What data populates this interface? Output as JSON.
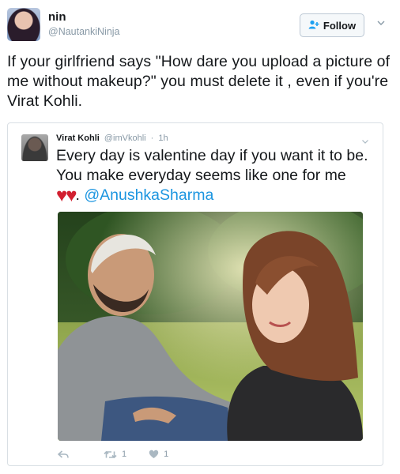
{
  "outer_tweet": {
    "display_name": "nin",
    "handle": "@NautankiNinja",
    "follow_label": "Follow",
    "text": "If your girlfriend says \"How dare you upload a picture of me without makeup?\" you must delete it , even if you're Virat Kohli."
  },
  "quoted_tweet": {
    "display_name": "Virat Kohli",
    "handle": "@imVkohli",
    "separator": "·",
    "time": "1h",
    "text_main": "Every day is valentine day if you want it to be. You make everyday seems like one for me",
    "hearts": "♥♥",
    "after_hearts": ". ",
    "mention": "@AnushkaSharma",
    "retweet_count": "1",
    "like_count": "1"
  },
  "icons": [
    "follow-person-icon",
    "caret-down-icon",
    "reply-icon",
    "retweet-icon",
    "like-icon"
  ],
  "colors": {
    "accent": "#1da1f2",
    "mention": "#1b95e0",
    "heart": "#d22030",
    "meta_gray": "#8899a6"
  }
}
